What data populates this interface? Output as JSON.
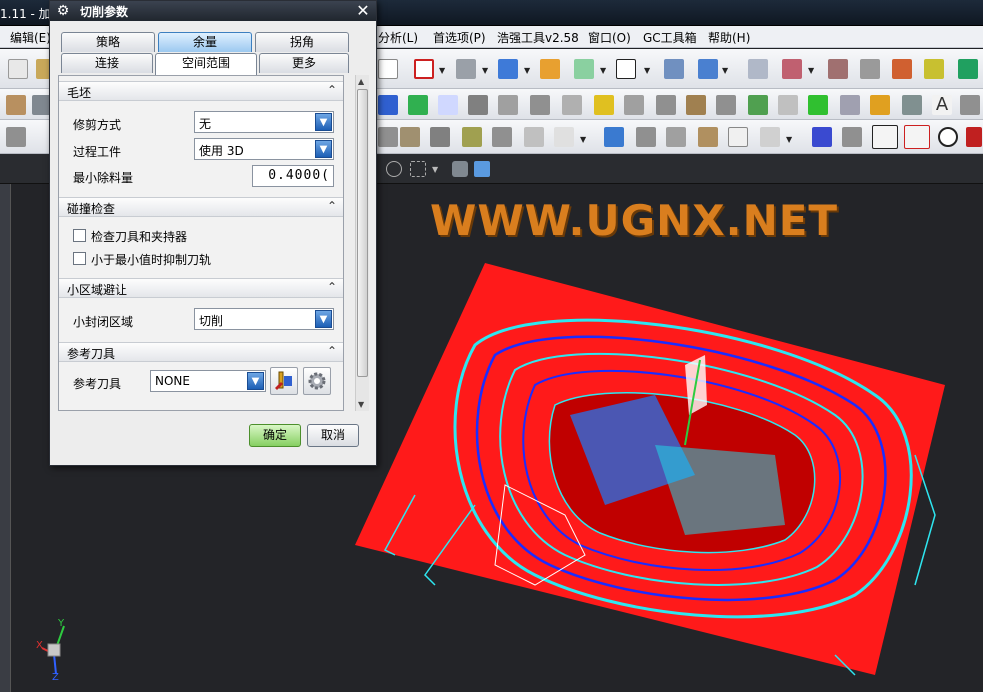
{
  "app": {
    "title_fragment": "1.11 - 加"
  },
  "menus": [
    {
      "label": "编辑(E)"
    },
    {
      "label": "分析(L)"
    },
    {
      "label": "首选项(P)"
    },
    {
      "label": "浩强工具v2.58"
    },
    {
      "label": "窗口(O)"
    },
    {
      "label": "GC工具箱"
    },
    {
      "label": "帮助(H)"
    }
  ],
  "viewport": {
    "watermark": "WWW.UGNX.NET",
    "triad": {
      "x": "X",
      "y": "Y",
      "z": "Z"
    }
  },
  "dialog": {
    "title": "切削参数",
    "tabs_row1": [
      "策略",
      "余量",
      "拐角"
    ],
    "tabs_row2": [
      "连接",
      "空间范围",
      "更多"
    ],
    "groups": {
      "blank": {
        "title": "毛坯",
        "trim_label": "修剪方式",
        "trim_value": "无",
        "ipw_label": "过程工件",
        "ipw_value": "使用 3D",
        "min_label": "最小除料量",
        "min_value": "0.4000("
      },
      "collision": {
        "title": "碰撞检查",
        "check_holder": "检查刀具和夹持器",
        "suppress": "小于最小值时抑制刀轨"
      },
      "small_area": {
        "title": "小区域避让",
        "closed_label": "小封闭区域",
        "closed_value": "切削"
      },
      "ref_tool": {
        "title": "参考刀具",
        "label": "参考刀具",
        "value": "NONE"
      }
    },
    "ok": "确定",
    "cancel": "取消"
  },
  "colors": {
    "accent": "#3c7fc0",
    "model_red": "#ff1a1a",
    "toolpath_blue": "#1a2cff",
    "toolpath_cyan": "#2ee6f0",
    "watermark": "#d97e1e"
  }
}
